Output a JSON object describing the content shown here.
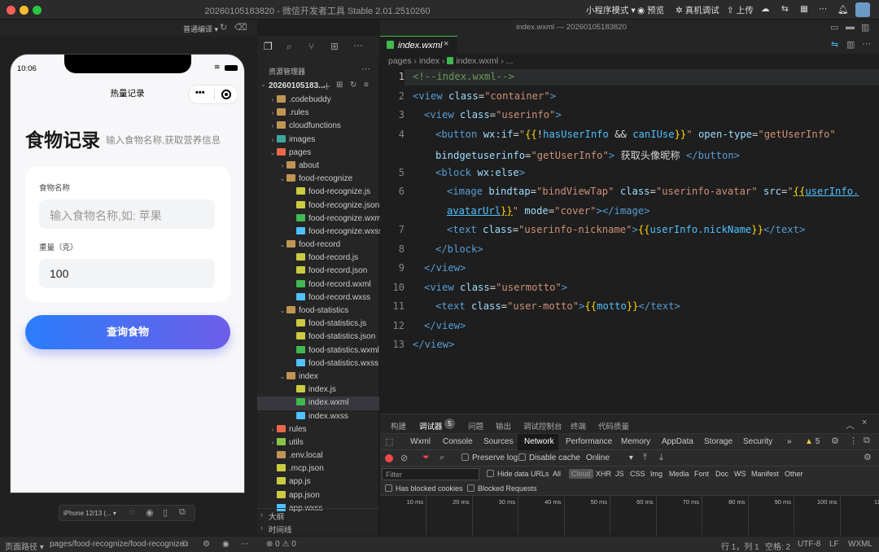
{
  "window": {
    "title": "20260105183820 - 微信开发者工具 Stable 2.01.2510260",
    "subtitle": "index.wxml — 20260105183820",
    "toolbar": [
      "小程序模式 ▾",
      "预览",
      "真机调试",
      "上传"
    ]
  },
  "simulator": {
    "compile_mode": "普通编译 ▾",
    "time": "10:06",
    "nav_title": "热量记录",
    "heading": "食物记录",
    "subheading": "输入食物名称,获取营养信息",
    "food_label": "食物名称",
    "food_placeholder": "输入食物名称,如: 苹果",
    "weight_label": "重量（克）",
    "weight_value": "100",
    "query_button": "查询食物",
    "device": "iPhone 12/13 (... ▾"
  },
  "explorer": {
    "title": "资源管理器",
    "project": "20260105183...",
    "tree": [
      {
        "depth": 1,
        "type": "folder",
        "name": ".codebuddy",
        "open": false
      },
      {
        "depth": 1,
        "type": "folder",
        "name": ".rules",
        "open": false
      },
      {
        "depth": 1,
        "type": "folder",
        "name": "cloudfunctions",
        "open": false
      },
      {
        "depth": 1,
        "type": "img",
        "name": "images",
        "open": false
      },
      {
        "depth": 1,
        "type": "pages",
        "name": "pages",
        "open": true
      },
      {
        "depth": 2,
        "type": "folder",
        "name": "about",
        "open": false
      },
      {
        "depth": 2,
        "type": "folder",
        "name": "food-recognize",
        "open": true
      },
      {
        "depth": 3,
        "type": "js",
        "name": "food-recognize.js"
      },
      {
        "depth": 3,
        "type": "json",
        "name": "food-recognize.json"
      },
      {
        "depth": 3,
        "type": "wxml",
        "name": "food-recognize.wxml"
      },
      {
        "depth": 3,
        "type": "wxss",
        "name": "food-recognize.wxss"
      },
      {
        "depth": 2,
        "type": "folder",
        "name": "food-record",
        "open": true
      },
      {
        "depth": 3,
        "type": "js",
        "name": "food-record.js"
      },
      {
        "depth": 3,
        "type": "json",
        "name": "food-record.json"
      },
      {
        "depth": 3,
        "type": "wxml",
        "name": "food-record.wxml"
      },
      {
        "depth": 3,
        "type": "wxss",
        "name": "food-record.wxss"
      },
      {
        "depth": 2,
        "type": "folder",
        "name": "food-statistics",
        "open": true
      },
      {
        "depth": 3,
        "type": "js",
        "name": "food-statistics.js"
      },
      {
        "depth": 3,
        "type": "json",
        "name": "food-statistics.json"
      },
      {
        "depth": 3,
        "type": "wxml",
        "name": "food-statistics.wxml"
      },
      {
        "depth": 3,
        "type": "wxss",
        "name": "food-statistics.wxss"
      },
      {
        "depth": 2,
        "type": "folder",
        "name": "index",
        "open": true
      },
      {
        "depth": 3,
        "type": "js",
        "name": "index.js"
      },
      {
        "depth": 3,
        "type": "wxml",
        "name": "index.wxml",
        "selected": true
      },
      {
        "depth": 3,
        "type": "wxss",
        "name": "index.wxss"
      },
      {
        "depth": 1,
        "type": "rules",
        "name": "rules",
        "open": false
      },
      {
        "depth": 1,
        "type": "utils",
        "name": "utils",
        "open": false
      },
      {
        "depth": 1,
        "type": "env",
        "name": ".env.local"
      },
      {
        "depth": 1,
        "type": "json",
        "name": ".mcp.json"
      },
      {
        "depth": 1,
        "type": "js",
        "name": "app.js"
      },
      {
        "depth": 1,
        "type": "json",
        "name": "app.json"
      },
      {
        "depth": 1,
        "type": "wxss",
        "name": "app.wxss"
      }
    ],
    "outline": "大纲",
    "timeline": "时间线"
  },
  "editor": {
    "tab": "index.wxml",
    "breadcrumb": [
      "pages",
      "index",
      "index.wxml",
      "..."
    ],
    "line_numbers": [
      "1",
      "2",
      "3",
      "4",
      "",
      "5",
      "6",
      "",
      "7",
      "8",
      "9",
      "10",
      "11",
      "12",
      "13"
    ]
  },
  "devtools": {
    "tabs": [
      "构建",
      "调试器",
      "问题",
      "输出",
      "调试控制台",
      "终端",
      "代码质量"
    ],
    "debugger_badge": "5",
    "panels": [
      "Wxml",
      "Console",
      "Sources",
      "Network",
      "Performance",
      "Memory",
      "AppData",
      "Storage",
      "Security"
    ],
    "more": "»",
    "warnings": "5",
    "preserve_log": "Preserve log",
    "disable_cache": "Disable cache",
    "throttle": "Online",
    "filter_placeholder": "Filter",
    "hide_data_urls": "Hide data URLs",
    "filters": [
      "All",
      "Cloud",
      "XHR",
      "JS",
      "CSS",
      "Img",
      "Media",
      "Font",
      "Doc",
      "WS",
      "Manifest",
      "Other"
    ],
    "blocked_cookies": "Has blocked cookies",
    "blocked_requests": "Blocked Requests",
    "ticks": [
      "10 ms",
      "20 ms",
      "30 ms",
      "40 ms",
      "50 ms",
      "60 ms",
      "70 ms",
      "80 ms",
      "90 ms",
      "100 ms",
      "110"
    ]
  },
  "statusbar": {
    "path_label": "页面路径 ▾",
    "path": "pages/food-recognize/food-recognize",
    "errors": "⊗ 0 ⚠ 0",
    "position": "行 1，列 1",
    "spaces": "空格: 2",
    "encoding": "UTF-8",
    "eol": "LF",
    "lang": "WXML"
  },
  "colors": {
    "accent": "#2a7dfc",
    "folder": "#d9a441",
    "wxml": "#3fb950"
  }
}
